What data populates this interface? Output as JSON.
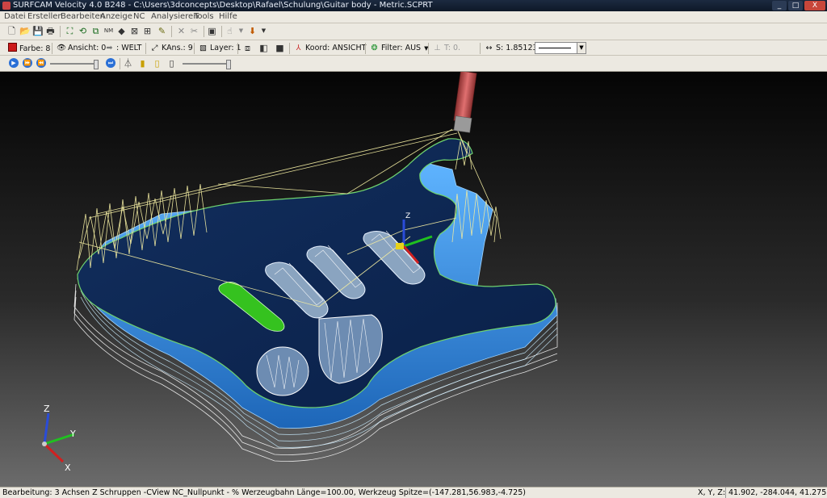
{
  "window": {
    "title": "SURFCAM Velocity 4.0 B248 - C:\\Users\\3dconcepts\\Desktop\\Rafael\\Schulung\\Guitar body - Metric.SCPRT",
    "minimize": "_",
    "maximize": "□",
    "close": "X"
  },
  "menu": [
    "Datei",
    "Erstellen",
    "Bearbeiten",
    "Anzeige",
    "NC",
    "Analysieren",
    "Tools",
    "Hilfe"
  ],
  "toolbar2": {
    "farbe": "Farbe: 8",
    "ansicht": "Ansicht: 0",
    "welt": ": WELT",
    "kans": "KAns.: 9",
    "layer": "Layer: 1",
    "koord": "Koord: ANSICHT",
    "filter": "Filter: AUS",
    "t": "T: 0.",
    "s": "S: 1.85123"
  },
  "colors": {
    "farbe_swatch": "#cc1a1a",
    "play": "#2a6fd6",
    "part_top": "#0d2a55",
    "part_side": "#3d9ae0",
    "toolpath": "#f0eaa0",
    "pocket_green": "#35c21f"
  },
  "triad": {
    "z": "Z",
    "y": "Y",
    "x": "X"
  },
  "status": {
    "message": "Bearbeitung: 3 Achsen Z Schruppen    -CView NC_Nullpunkt - % Werzeugbahn Länge=100.00, Werkzeug Spitze=(-147.281,56.983,-4.725)",
    "xyz_label": "X, Y, Z:",
    "xyz_value": "41.902, -284.044, 41.275"
  }
}
